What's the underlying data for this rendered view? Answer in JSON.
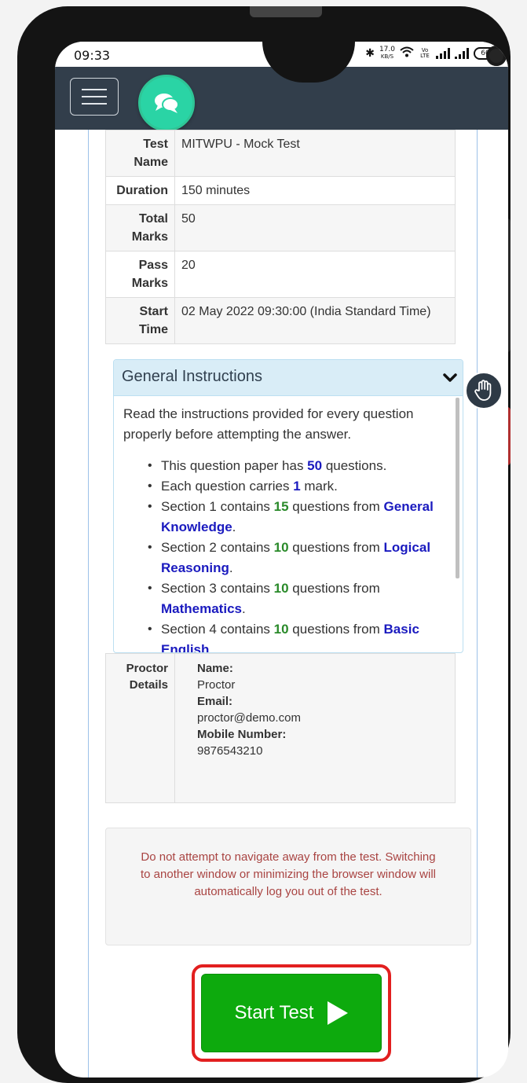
{
  "status_bar": {
    "time": "09:33",
    "net_speed_value": "17.0",
    "net_speed_unit": "KB/S",
    "volte": "Vo LTE",
    "battery": "60"
  },
  "header": {
    "menu_icon": "hamburger-icon",
    "chat_icon": "chat-bubbles-icon",
    "accent_color": "#2ad4a5",
    "bar_color": "#323e4b"
  },
  "test_info": [
    {
      "label": "Test Name",
      "value": "MITWPU - Mock Test"
    },
    {
      "label": "Duration",
      "value": "150 minutes"
    },
    {
      "label": "Total Marks",
      "value": "50"
    },
    {
      "label": "Pass Marks",
      "value": "20"
    },
    {
      "label": "Start Time",
      "value": "02 May 2022 09:30:00 (India Standard Time)"
    }
  ],
  "instructions": {
    "title": "General Instructions",
    "intro": "Read the instructions provided for every question properly before attempting the answer.",
    "items": {
      "i1": {
        "pre": "This question paper has ",
        "num": "50",
        "post": " questions."
      },
      "i2": {
        "pre": "Each question carries ",
        "num": "1",
        "post": " mark."
      },
      "i3": {
        "pre": "Section 1 contains ",
        "num": "15",
        "mid": " questions from ",
        "topic": "General Knowledge",
        "post": "."
      },
      "i4": {
        "pre": "Section 2 contains ",
        "num": "10",
        "mid": " questions from ",
        "topic": "Logical Reasoning",
        "post": "."
      },
      "i5": {
        "pre": "Section 3 contains ",
        "num": "10",
        "mid": " questions from ",
        "topic": "Mathematics",
        "post": "."
      },
      "i6": {
        "pre": "Section 4 contains ",
        "num": "10",
        "mid": " questions from ",
        "topic": "Basic English",
        "post": "."
      }
    }
  },
  "proctor": {
    "label": "Proctor Details",
    "name_label": "Name:",
    "name": "Proctor",
    "email_label": "Email:",
    "email": "proctor@demo.com",
    "mobile_label": "Mobile Number:",
    "mobile": "9876543210"
  },
  "warning": "Do not attempt to navigate away from the test. Switching to another window or minimizing the browser window will automatically log you out of the test.",
  "start_button": {
    "label": "Start Test",
    "color": "#0daa0d",
    "highlight_color": "#e21f1f"
  }
}
